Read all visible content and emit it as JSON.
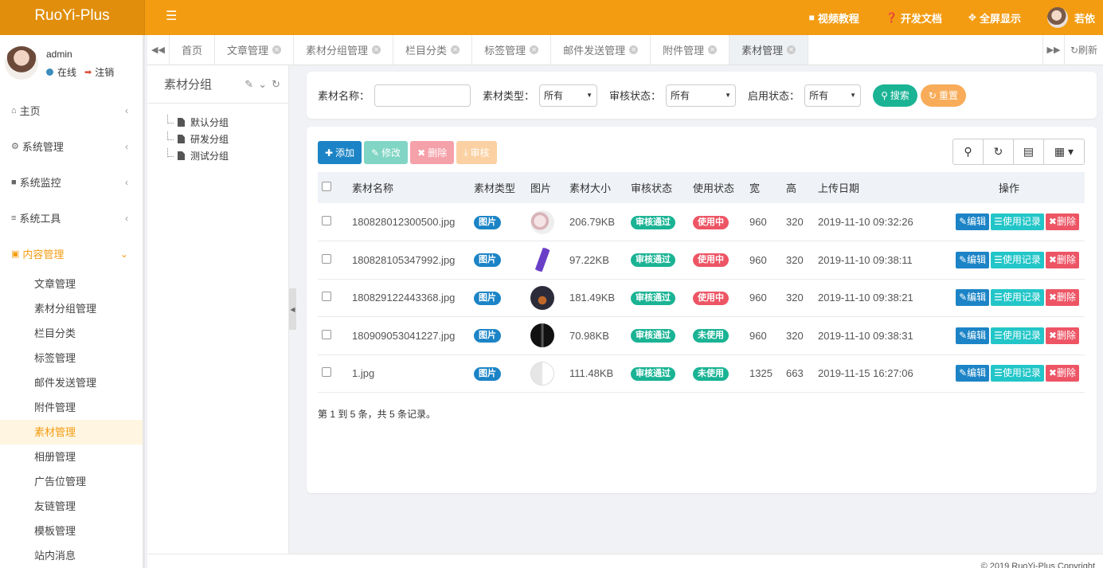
{
  "brand": "RuoYi-Plus",
  "topnav": {
    "video": "视频教程",
    "docs": "开发文档",
    "fullscreen": "全屏显示",
    "username": "若依"
  },
  "profile": {
    "name": "admin",
    "status": "在线",
    "logout": "注销"
  },
  "menu": [
    {
      "label": "主页",
      "icon": "home-icon"
    },
    {
      "label": "系统管理",
      "icon": "gear-icon"
    },
    {
      "label": "系统监控",
      "icon": "video-icon"
    },
    {
      "label": "系统工具",
      "icon": "bars-icon"
    },
    {
      "label": "内容管理",
      "icon": "id-card-icon",
      "active": true
    }
  ],
  "submenu": [
    "文章管理",
    "素材分组管理",
    "栏目分类",
    "标签管理",
    "邮件发送管理",
    "附件管理",
    "素材管理",
    "相册管理",
    "广告位管理",
    "友链管理",
    "模板管理",
    "站内消息"
  ],
  "tabs": [
    {
      "label": "首页"
    },
    {
      "label": "文章管理"
    },
    {
      "label": "素材分组管理"
    },
    {
      "label": "栏目分类"
    },
    {
      "label": "标签管理"
    },
    {
      "label": "邮件发送管理"
    },
    {
      "label": "附件管理"
    },
    {
      "label": "素材管理",
      "active": true
    }
  ],
  "refresh": "刷新",
  "tree": {
    "title": "素材分组",
    "nodes": [
      "默认分组",
      "研发分组",
      "测试分组"
    ]
  },
  "filters": {
    "name_label": "素材名称：",
    "name_value": "",
    "type_label": "素材类型：",
    "type_value": "所有",
    "audit_label": "审核状态：",
    "audit_value": "所有",
    "enable_label": "启用状态：",
    "enable_value": "所有",
    "search": "搜索",
    "reset": "重置"
  },
  "toolbar": {
    "add": "添加",
    "edit": "修改",
    "delete": "删除",
    "audit": "审核"
  },
  "table": {
    "headers": [
      "素材名称",
      "素材类型",
      "图片",
      "素材大小",
      "审核状态",
      "使用状态",
      "宽",
      "高",
      "上传日期",
      "操作"
    ],
    "rows": [
      {
        "name": "180828012300500.jpg",
        "type": "图片",
        "size": "206.79KB",
        "audit": "审核通过",
        "use": "使用中",
        "w": "960",
        "h": "320",
        "date": "2019-11-10 09:32:26",
        "thumb": "thumb-light"
      },
      {
        "name": "180828105347992.jpg",
        "type": "图片",
        "size": "97.22KB",
        "audit": "审核通过",
        "use": "使用中",
        "w": "960",
        "h": "320",
        "date": "2019-11-10 09:38:11",
        "thumb": "thumb-purple"
      },
      {
        "name": "180829122443368.jpg",
        "type": "图片",
        "size": "181.49KB",
        "audit": "审核通过",
        "use": "使用中",
        "w": "960",
        "h": "320",
        "date": "2019-11-10 09:38:21",
        "thumb": "thumb-dark-orange"
      },
      {
        "name": "180909053041227.jpg",
        "type": "图片",
        "size": "70.98KB",
        "audit": "审核通过",
        "use": "未使用",
        "w": "960",
        "h": "320",
        "date": "2019-11-10 09:38:31",
        "thumb": "thumb-dark"
      },
      {
        "name": "1.jpg",
        "type": "图片",
        "size": "111.48KB",
        "audit": "审核通过",
        "use": "未使用",
        "w": "1325",
        "h": "663",
        "date": "2019-11-15 16:27:06",
        "thumb": "thumb-gray"
      }
    ],
    "actions": {
      "edit": "编辑",
      "record": "使用记录",
      "delete": "删除"
    }
  },
  "pagination": "第 1 到 5 条，共 5 条记录。",
  "footer": "© 2019 RuoYi-Plus Copyright",
  "colors": {
    "accent": "#f39c12",
    "primary": "#1c84c6",
    "success": "#1ab394",
    "danger": "#ed5565",
    "info": "#23c6c8"
  }
}
